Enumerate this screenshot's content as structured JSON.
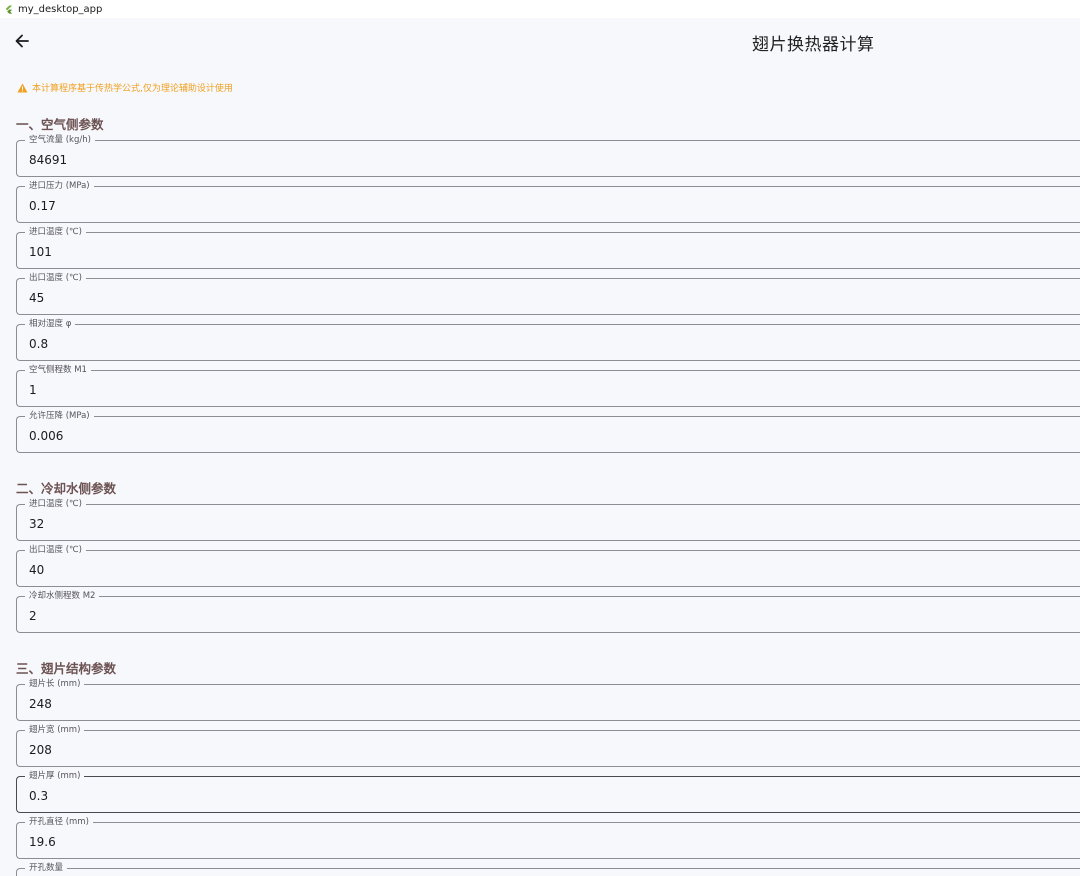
{
  "window": {
    "title": "my_desktop_app",
    "icon": "flutter-icon"
  },
  "appbar": {
    "back_icon": "arrow-left-icon",
    "title": "翅片换热器计算"
  },
  "warning": {
    "icon": "warning-triangle-icon",
    "text": "本计算程序基于传热学公式,仅为理论辅助设计使用",
    "color": "#f0a020"
  },
  "sections": [
    {
      "title": "一、空气侧参数",
      "fields": [
        {
          "label": "空气流量 (kg/h)",
          "value": "84691"
        },
        {
          "label": "进口压力 (MPa)",
          "value": "0.17"
        },
        {
          "label": "进口温度 (℃)",
          "value": "101"
        },
        {
          "label": "出口温度 (℃)",
          "value": "45"
        },
        {
          "label": "相对湿度 φ",
          "value": "0.8"
        },
        {
          "label": "空气侧程数 M1",
          "value": "1"
        },
        {
          "label": "允许压降 (MPa)",
          "value": "0.006"
        }
      ]
    },
    {
      "title": "二、冷却水侧参数",
      "fields": [
        {
          "label": "进口温度 (℃)",
          "value": "32"
        },
        {
          "label": "出口温度 (℃)",
          "value": "40"
        },
        {
          "label": "冷却水侧程数 M2",
          "value": "2"
        }
      ]
    },
    {
      "title": "三、翅片结构参数",
      "fields": [
        {
          "label": "翅片长 (mm)",
          "value": "248"
        },
        {
          "label": "翅片宽 (mm)",
          "value": "208"
        },
        {
          "label": "翅片厚 (mm)",
          "value": "0.3"
        },
        {
          "label": "开孔直径 (mm)",
          "value": "19.6"
        },
        {
          "label": "开孔数量",
          "value": ""
        }
      ]
    }
  ],
  "colors": {
    "background": "#f7f8fc",
    "section_title": "#6d5353",
    "border": "#8c8c94"
  }
}
